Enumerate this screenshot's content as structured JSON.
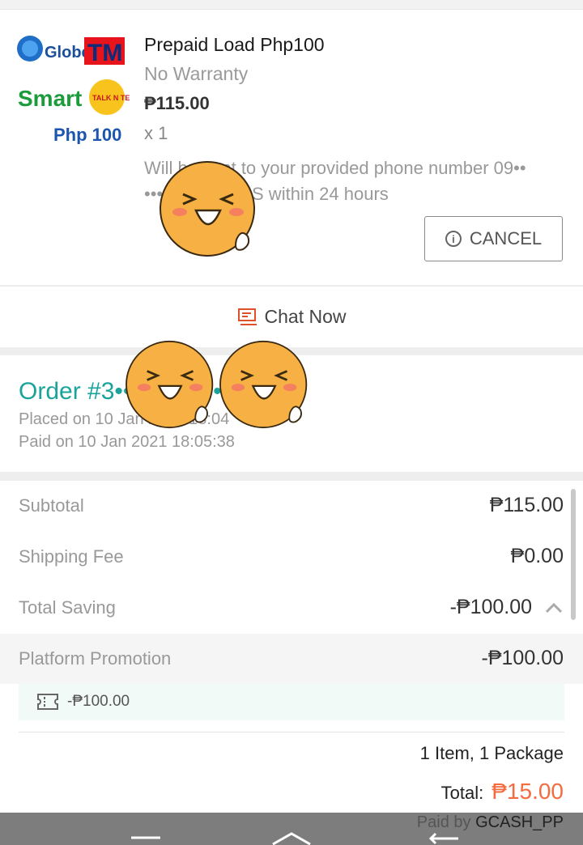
{
  "product": {
    "logo_text": [
      "Globe",
      "TM",
      "Smart",
      "TALK N TEXT",
      "Php 100"
    ],
    "title": "Prepaid Load Php100",
    "warranty": "No Warranty",
    "price": "₱115.00",
    "quantity": "x 1",
    "note": "Will be sent to your provided phone number 09•• ••• •••9 by SMS within 24 hours",
    "cancel_label": "CANCEL"
  },
  "chat": {
    "label": "Chat Now"
  },
  "order": {
    "number": "Order #3•••••••••9•••8",
    "placed": "Placed on 10 Jan 2021  18:04",
    "paid": "Paid on 10 Jan 2021  18:05:38"
  },
  "summary": {
    "subtotal_label": "Subtotal",
    "subtotal_value": "₱115.00",
    "shipping_label": "Shipping Fee",
    "shipping_value": "₱0.00",
    "saving_label": "Total Saving",
    "saving_value": "-₱100.00",
    "promo_label": "Platform Promotion",
    "promo_value": "-₱100.00",
    "voucher_value": "-₱100.00",
    "items": "1 Item, 1 Package",
    "total_label": "Total:",
    "total_value": "₱15.00",
    "paid_by_label": "Paid by",
    "paid_by_value": "GCASH_PP"
  },
  "colors": {
    "accent_teal": "#1aa39a",
    "total_orange": "#f36c3f",
    "chat_icon": "#e0502b"
  },
  "icons": [
    "info-icon",
    "chat-icon",
    "chevron-up-icon",
    "voucher-icon",
    "menu-icon",
    "home-icon",
    "back-icon"
  ]
}
